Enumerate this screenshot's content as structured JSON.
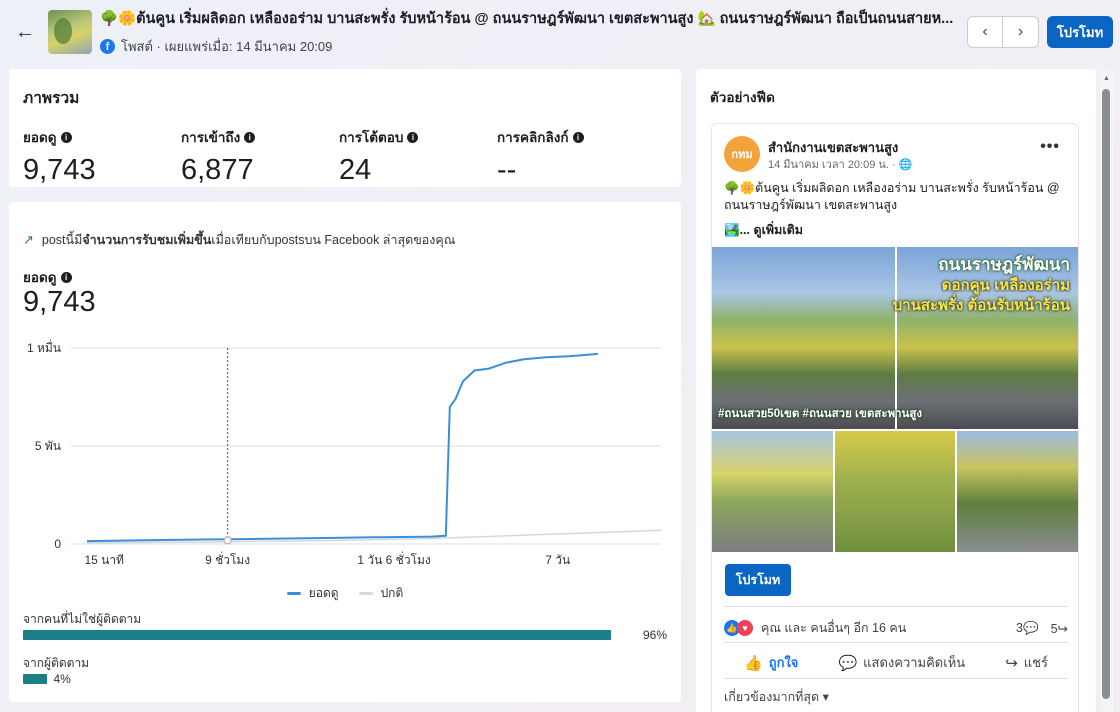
{
  "header": {
    "back_icon": "arrow-left-icon",
    "post_title": "🌳🌼ต้นคูน เริ่มผลิดอก เหลืองอร่าม บานสะพรั่ง รับหน้าร้อน @ ถนนราษฎร์พัฒนา เขตสะพานสูง 🏡 ถนนราษฎร์พัฒนา ถือเป็นถนนสายห...",
    "meta": "โพสต์ · เผยแพร่เมื่อ: 14 มีนาคม 20:09",
    "prev_icon": "chevron-left-icon",
    "next_icon": "chevron-right-icon",
    "promote_label": "โปรโมท"
  },
  "overview": {
    "title": "ภาพรวม",
    "metrics": [
      {
        "label": "ยอดดู",
        "value": "9,743"
      },
      {
        "label": "การเข้าถึง",
        "value": "6,877"
      },
      {
        "label": "การโต้ตอบ",
        "value": "24"
      },
      {
        "label": "การคลิกลิงก์",
        "value": "--"
      }
    ]
  },
  "performance": {
    "trend_prefix": "postนี้มี",
    "trend_bold": "จำนวนการรับชมเพิ่มขึ้น",
    "trend_suffix": "เมื่อเทียบกับpostsบน Facebook ล่าสุดของคุณ",
    "views_label": "ยอดดู",
    "views_value": "9,743",
    "legend": [
      {
        "name": "ยอดดู",
        "color": "#3b8fd8"
      },
      {
        "name": "ปกติ",
        "color": "#d5d7da"
      }
    ]
  },
  "chart_data": {
    "type": "line",
    "x_ticks": [
      "15 นาที",
      "9 ชั่วโมง",
      "1 วัน 6 ชั่วโมง",
      "7 วัน"
    ],
    "y_ticks": [
      "0",
      "5 พัน",
      "1 หมื่น"
    ],
    "ylim": [
      0,
      10000
    ],
    "marker_x": 0.245,
    "series": [
      {
        "name": "ยอดดู",
        "color": "#3b8fd8",
        "points": [
          [
            0.0,
            150
          ],
          [
            0.1,
            190
          ],
          [
            0.2,
            230
          ],
          [
            0.3,
            260
          ],
          [
            0.4,
            300
          ],
          [
            0.5,
            340
          ],
          [
            0.6,
            380
          ],
          [
            0.625,
            420
          ],
          [
            0.632,
            7000
          ],
          [
            0.642,
            7400
          ],
          [
            0.655,
            8300
          ],
          [
            0.675,
            8850
          ],
          [
            0.7,
            8950
          ],
          [
            0.73,
            9250
          ],
          [
            0.76,
            9420
          ],
          [
            0.8,
            9530
          ],
          [
            0.84,
            9580
          ],
          [
            0.87,
            9650
          ],
          [
            0.89,
            9700
          ]
        ]
      },
      {
        "name": "ปกติ",
        "color": "#d5d7da",
        "points": [
          [
            0.0,
            60
          ],
          [
            0.2,
            100
          ],
          [
            0.4,
            170
          ],
          [
            0.6,
            280
          ],
          [
            0.8,
            490
          ],
          [
            1.0,
            700
          ]
        ]
      }
    ]
  },
  "sources": [
    {
      "label": "จากคนที่ไม่ใช่ผู้ติดตาม",
      "value": 96,
      "pct": "96%"
    },
    {
      "label": "จากผู้ติดตาม",
      "value": 4,
      "pct": "4%"
    }
  ],
  "feed": {
    "title": "ตัวอย่างฟีด",
    "avatar_text": "กทม",
    "page_name": "สำนักงานเขตสะพานสูง",
    "post_time": "14 มีนาคม เวลา 20:09 น. · ",
    "globe_icon": "globe-icon",
    "more_icon": "more-dots-icon",
    "post_text": "🌳🌼ต้นคูน เริ่มผลิดอก เหลืองอร่าม บานสะพรั่ง รับหน้าร้อน @ ถนนราษฎร์พัฒนา เขตสะพานสูง",
    "see_more": "🏞️... ดูเพิ่มเติม",
    "overlay_title": "ถนนราษฎร์พัฒนา",
    "overlay_sub": "ดอกคูน เหลืองอร่าม",
    "overlay_sub2": "บานสะพรั่ง ต้อนรับหน้าร้อน",
    "overlay_tags": "#ถนนสวย50เขต  #ถนนสวย เขตสะพานสูง",
    "promote_label": "โปรโมท",
    "reactions_text": "คุณ และ คนอื่นๆ อีก 16 คน",
    "comments_count": "3💬",
    "shares_count": "5↪",
    "like_label": "ถูกใจ",
    "comment_label": "แสดงความคิดเห็น",
    "share_label": "แชร์",
    "relevant_label": "เกี่ยวข้องมากที่สุด ▾"
  }
}
